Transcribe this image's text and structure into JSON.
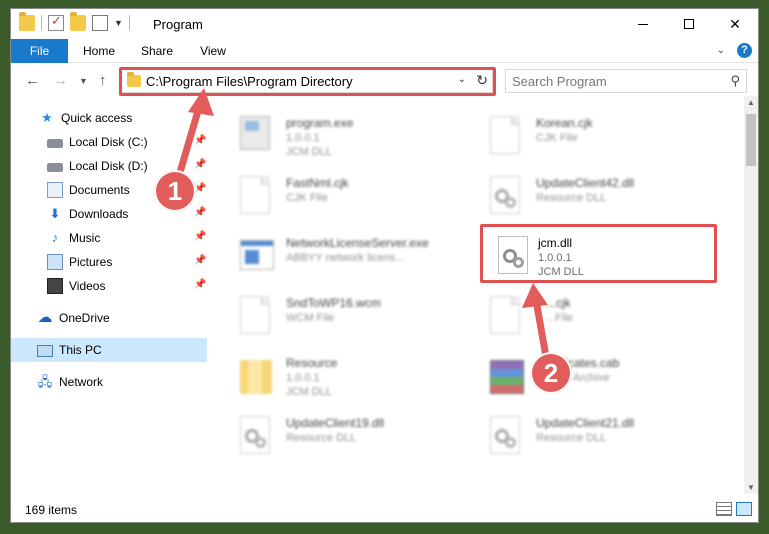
{
  "window": {
    "title": "Program"
  },
  "ribbon": {
    "tabs": [
      "File",
      "Home",
      "Share",
      "View"
    ]
  },
  "address": {
    "path": "C:\\Program Files\\Program Directory"
  },
  "search": {
    "placeholder": "Search Program"
  },
  "sidebar": {
    "items": [
      {
        "label": "Quick access",
        "icon": "star-icon",
        "pinned": false
      },
      {
        "label": "Local Disk (C:)",
        "icon": "disk-icon",
        "pinned": true
      },
      {
        "label": "Local Disk (D:)",
        "icon": "disk-icon",
        "pinned": true
      },
      {
        "label": "Documents",
        "icon": "documents-icon",
        "pinned": true
      },
      {
        "label": "Downloads",
        "icon": "downloads-icon",
        "pinned": true
      },
      {
        "label": "Music",
        "icon": "music-icon",
        "pinned": true
      },
      {
        "label": "Pictures",
        "icon": "pictures-icon",
        "pinned": true
      },
      {
        "label": "Videos",
        "icon": "videos-icon",
        "pinned": true
      },
      {
        "label": "OneDrive",
        "icon": "cloud-icon",
        "pinned": false
      },
      {
        "label": "This PC",
        "icon": "computer-icon",
        "pinned": false,
        "selected": true
      },
      {
        "label": "Network",
        "icon": "network-icon",
        "pinned": false
      }
    ]
  },
  "files": [
    {
      "name": "program.exe",
      "line2": "1.0.0.1",
      "line3": "JCM DLL",
      "icon": "exe-icon"
    },
    {
      "name": "Korean.cjk",
      "line2": "CJK File",
      "line3": "",
      "icon": "document-icon"
    },
    {
      "name": "FastNml.cjk",
      "line2": "CJK File",
      "line3": "",
      "icon": "document-icon"
    },
    {
      "name": "UpdateClient42.dll",
      "line2": "Resource DLL",
      "line3": "",
      "icon": "dll-icon"
    },
    {
      "name": "NetworkLicenseServer.exe",
      "line2": "ABBYY network licens...",
      "line3": "",
      "icon": "window-icon"
    },
    {
      "name": "jcm.dll",
      "line2": "1.0.0.1",
      "line3": "JCM DLL",
      "icon": "dll-icon"
    },
    {
      "name": "SndToWP16.wcm",
      "line2": "WCM File",
      "line3": "",
      "icon": "document-icon"
    },
    {
      "name": "...cjk",
      "line2": "...File",
      "line3": "",
      "icon": "document-icon"
    },
    {
      "name": "Resource",
      "line2": "1.0.0.1",
      "line3": "JCM DLL",
      "icon": "folder-icon"
    },
    {
      "name": "...tificates.cab",
      "line2": "...AR Archive",
      "line3": "",
      "icon": "archive-icon"
    },
    {
      "name": "UpdateClient19.dll",
      "line2": "Resource DLL",
      "line3": "",
      "icon": "dll-icon"
    },
    {
      "name": "UpdateClient21.dll",
      "line2": "Resource DLL",
      "line3": "",
      "icon": "dll-icon"
    }
  ],
  "status": {
    "item_count": "169 items"
  },
  "callouts": [
    "1",
    "2"
  ],
  "colors": {
    "accent": "#1979ca",
    "highlight": "#e05050",
    "badge": "#e25c5c"
  }
}
